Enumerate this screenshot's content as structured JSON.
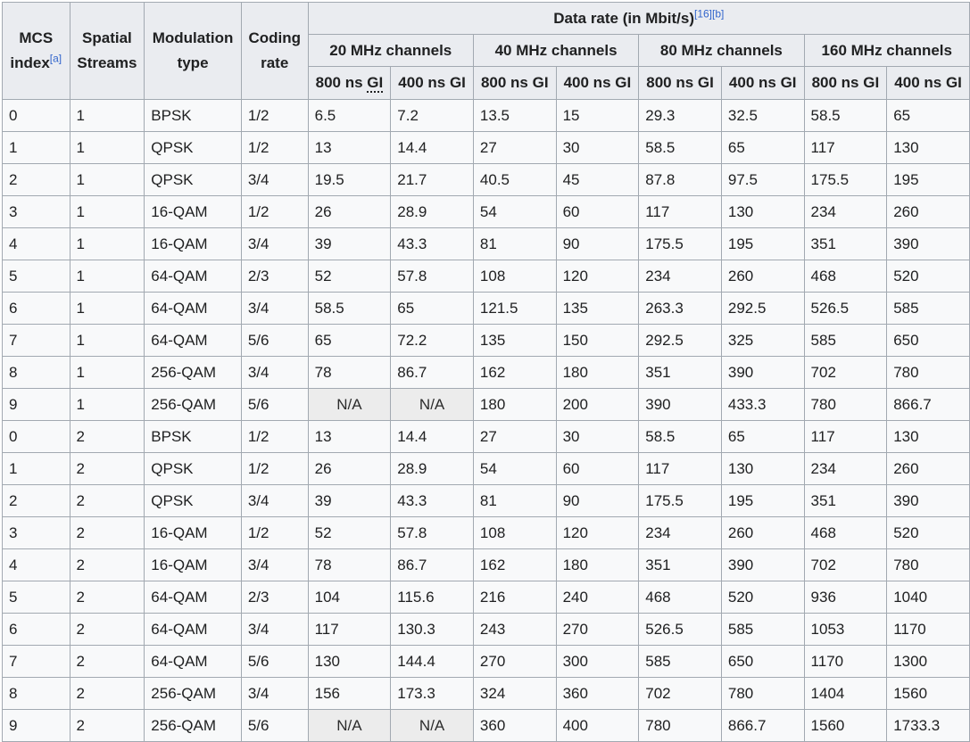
{
  "table": {
    "headers": {
      "mcs_index": "MCS index",
      "mcs_index_ref": "[a]",
      "spatial_streams": "Spatial Streams",
      "modulation_type": "Modulation type",
      "coding_rate": "Coding rate",
      "data_rate": "Data rate (in Mbit/s)",
      "data_rate_ref1": "[16]",
      "data_rate_ref2": "[b]",
      "channels": [
        "20 MHz channels",
        "40 MHz channels",
        "80 MHz channels",
        "160 MHz channels"
      ],
      "gi_prefix_800": "800 ns ",
      "gi_prefix_400": "400 ns ",
      "gi_abbr": "GI"
    },
    "rows": [
      [
        "0",
        "1",
        "BPSK",
        "1/2",
        "6.5",
        "7.2",
        "13.5",
        "15",
        "29.3",
        "32.5",
        "58.5",
        "65"
      ],
      [
        "1",
        "1",
        "QPSK",
        "1/2",
        "13",
        "14.4",
        "27",
        "30",
        "58.5",
        "65",
        "117",
        "130"
      ],
      [
        "2",
        "1",
        "QPSK",
        "3/4",
        "19.5",
        "21.7",
        "40.5",
        "45",
        "87.8",
        "97.5",
        "175.5",
        "195"
      ],
      [
        "3",
        "1",
        "16-QAM",
        "1/2",
        "26",
        "28.9",
        "54",
        "60",
        "117",
        "130",
        "234",
        "260"
      ],
      [
        "4",
        "1",
        "16-QAM",
        "3/4",
        "39",
        "43.3",
        "81",
        "90",
        "175.5",
        "195",
        "351",
        "390"
      ],
      [
        "5",
        "1",
        "64-QAM",
        "2/3",
        "52",
        "57.8",
        "108",
        "120",
        "234",
        "260",
        "468",
        "520"
      ],
      [
        "6",
        "1",
        "64-QAM",
        "3/4",
        "58.5",
        "65",
        "121.5",
        "135",
        "263.3",
        "292.5",
        "526.5",
        "585"
      ],
      [
        "7",
        "1",
        "64-QAM",
        "5/6",
        "65",
        "72.2",
        "135",
        "150",
        "292.5",
        "325",
        "585",
        "650"
      ],
      [
        "8",
        "1",
        "256-QAM",
        "3/4",
        "78",
        "86.7",
        "162",
        "180",
        "351",
        "390",
        "702",
        "780"
      ],
      [
        "9",
        "1",
        "256-QAM",
        "5/6",
        "N/A",
        "N/A",
        "180",
        "200",
        "390",
        "433.3",
        "780",
        "866.7"
      ],
      [
        "0",
        "2",
        "BPSK",
        "1/2",
        "13",
        "14.4",
        "27",
        "30",
        "58.5",
        "65",
        "117",
        "130"
      ],
      [
        "1",
        "2",
        "QPSK",
        "1/2",
        "26",
        "28.9",
        "54",
        "60",
        "117",
        "130",
        "234",
        "260"
      ],
      [
        "2",
        "2",
        "QPSK",
        "3/4",
        "39",
        "43.3",
        "81",
        "90",
        "175.5",
        "195",
        "351",
        "390"
      ],
      [
        "3",
        "2",
        "16-QAM",
        "1/2",
        "52",
        "57.8",
        "108",
        "120",
        "234",
        "260",
        "468",
        "520"
      ],
      [
        "4",
        "2",
        "16-QAM",
        "3/4",
        "78",
        "86.7",
        "162",
        "180",
        "351",
        "390",
        "702",
        "780"
      ],
      [
        "5",
        "2",
        "64-QAM",
        "2/3",
        "104",
        "115.6",
        "216",
        "240",
        "468",
        "520",
        "936",
        "1040"
      ],
      [
        "6",
        "2",
        "64-QAM",
        "3/4",
        "117",
        "130.3",
        "243",
        "270",
        "526.5",
        "585",
        "1053",
        "1170"
      ],
      [
        "7",
        "2",
        "64-QAM",
        "5/6",
        "130",
        "144.4",
        "270",
        "300",
        "585",
        "650",
        "1170",
        "1300"
      ],
      [
        "8",
        "2",
        "256-QAM",
        "3/4",
        "156",
        "173.3",
        "324",
        "360",
        "702",
        "780",
        "1404",
        "1560"
      ],
      [
        "9",
        "2",
        "256-QAM",
        "5/6",
        "N/A",
        "N/A",
        "360",
        "400",
        "780",
        "866.7",
        "1560",
        "1733.3"
      ]
    ]
  },
  "colors": {
    "header_bg": "#eaecf0",
    "cell_bg": "#f8f9fa",
    "na_bg": "#ececec",
    "border": "#a2a9b1",
    "link": "#3366cc"
  }
}
